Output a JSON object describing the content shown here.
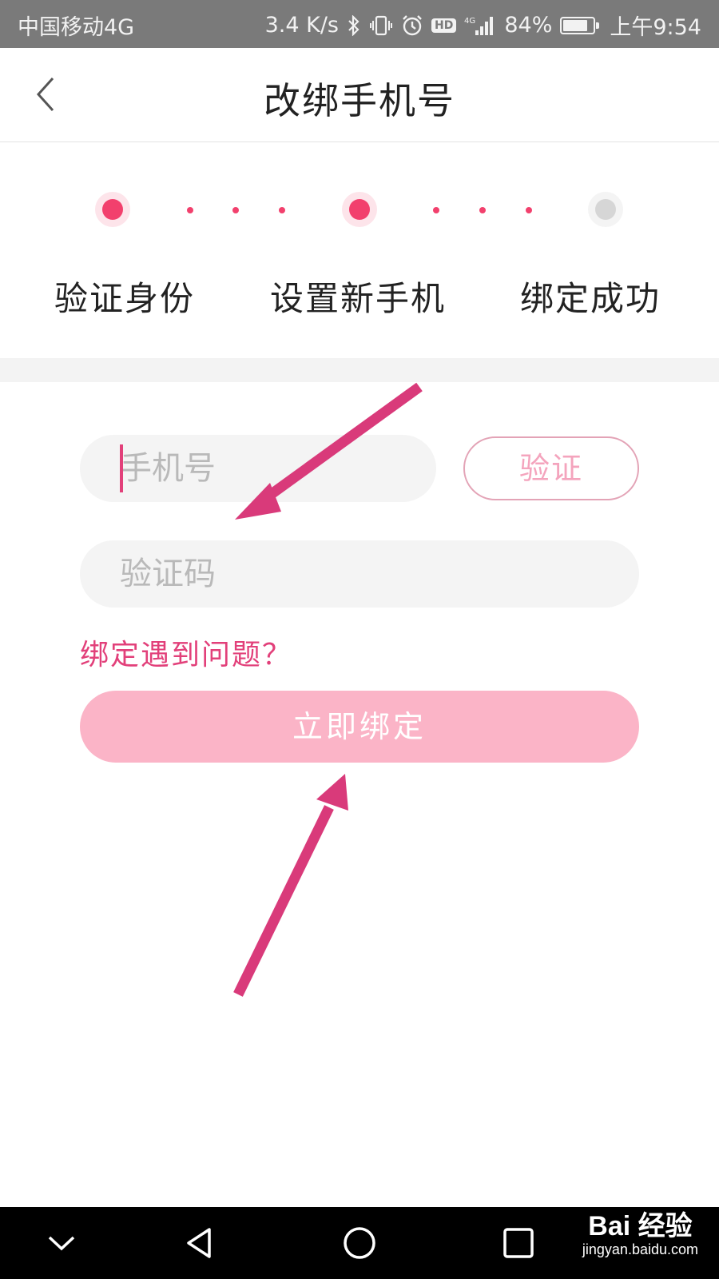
{
  "status_bar": {
    "carrier": "中国移动4G",
    "speed": "3.4 K/s",
    "hd": "HD",
    "network": "4G",
    "battery_percent_text": "84%",
    "battery_level": 0.84,
    "time": "上午9:54"
  },
  "header": {
    "title": "改绑手机号",
    "back_icon": "chevron-left-icon"
  },
  "steps": [
    {
      "label": "验证身份",
      "state": "active"
    },
    {
      "label": "设置新手机",
      "state": "active"
    },
    {
      "label": "绑定成功",
      "state": "pending"
    }
  ],
  "form": {
    "phone_placeholder": "手机号",
    "verify_button": "验证",
    "code_placeholder": "验证码",
    "problem_link": "绑定遇到问题？",
    "bind_button": "立即绑定"
  },
  "colors": {
    "accent": "#f2406d",
    "link": "#e2407a",
    "button_disabled": "#fbb4c7",
    "annotation_arrow": "#d93a7a"
  },
  "nav_bar": {
    "icons": [
      "chevron-down-icon",
      "back-triangle-icon",
      "home-circle-icon",
      "recents-square-icon"
    ]
  },
  "watermark": {
    "brand": "Bai 经验",
    "url": "jingyan.baidu.com"
  }
}
